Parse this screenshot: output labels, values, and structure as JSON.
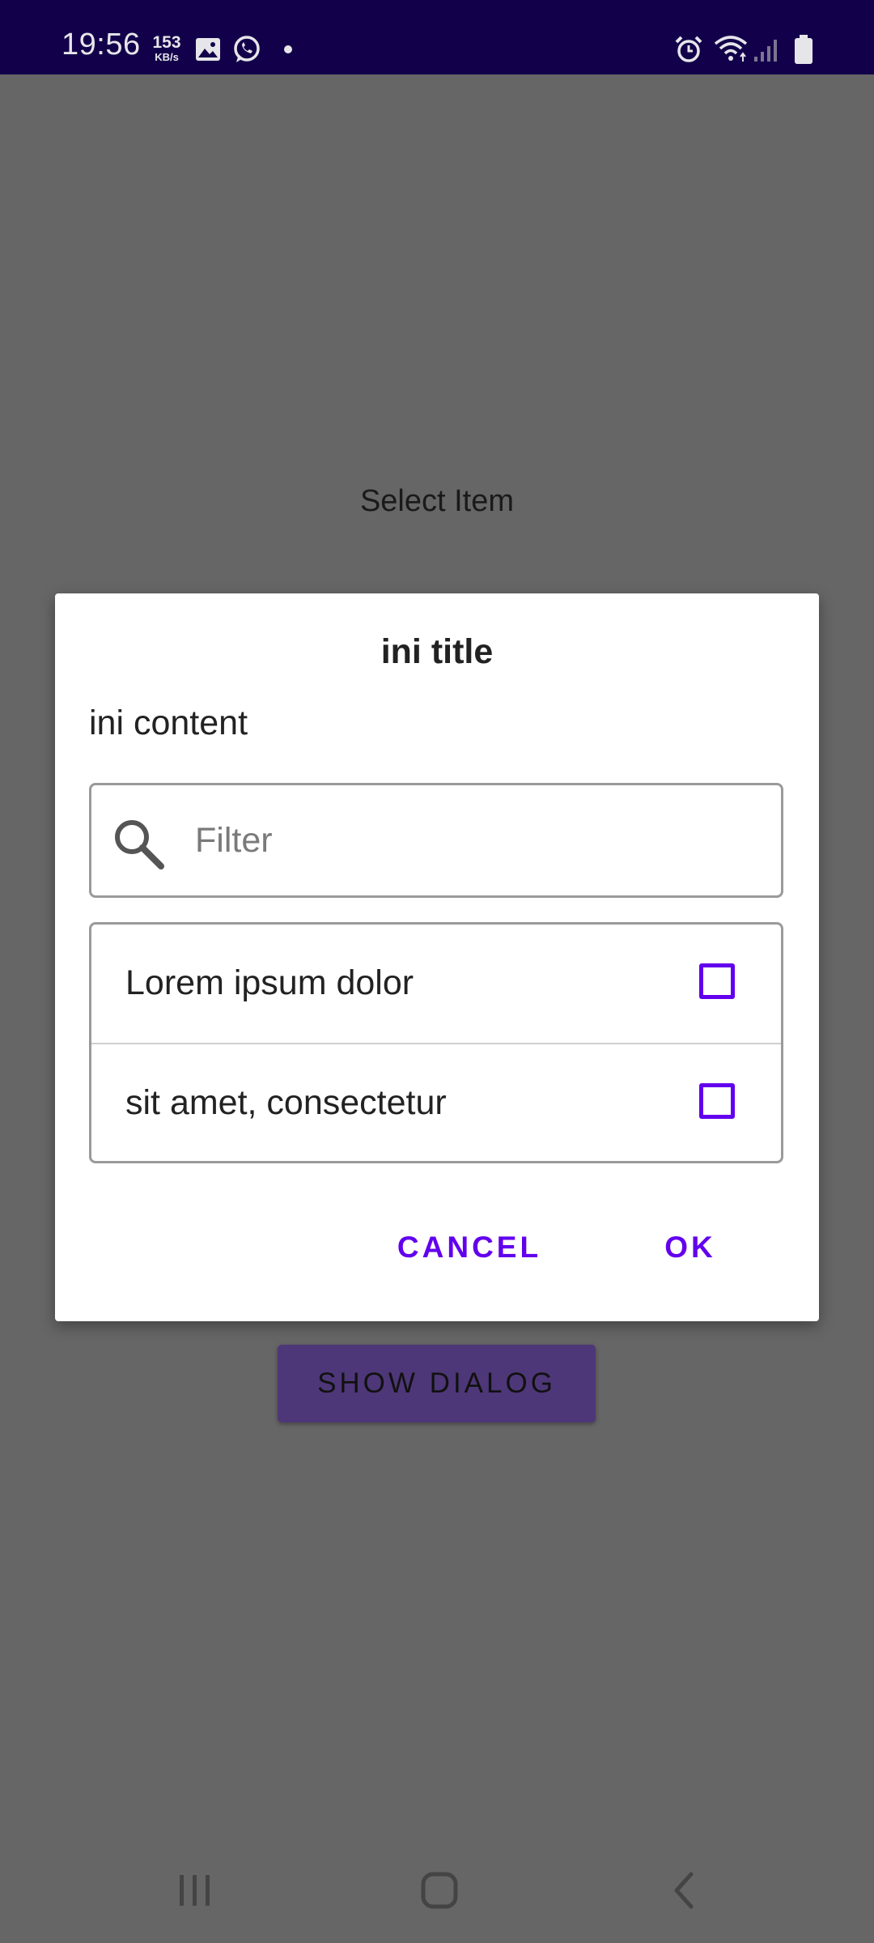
{
  "status_bar": {
    "time": "19:56",
    "net_speed_value": "153",
    "net_speed_unit": "KB/s",
    "icons": [
      "gallery-icon",
      "whatsapp-icon",
      "notification-dot-icon",
      "alarm-icon",
      "wifi-icon",
      "signal-icon",
      "battery-icon"
    ]
  },
  "background": {
    "label": "Select Item",
    "show_dialog_button": "SHOW DIALOG"
  },
  "dialog": {
    "title": "ini title",
    "content": "ini content",
    "filter_placeholder": "Filter",
    "items": [
      {
        "label": "Lorem ipsum dolor",
        "checked": false
      },
      {
        "label": "sit amet, consectetur",
        "checked": false
      }
    ],
    "cancel_label": "CANCEL",
    "ok_label": "OK"
  },
  "nav_bar": {
    "icons": [
      "recents-icon",
      "home-icon",
      "back-icon"
    ]
  },
  "colors": {
    "status_bar": "#13004a",
    "accent": "#6200ee",
    "scrim_background": "#666666",
    "button_bg": "#4e3778"
  }
}
